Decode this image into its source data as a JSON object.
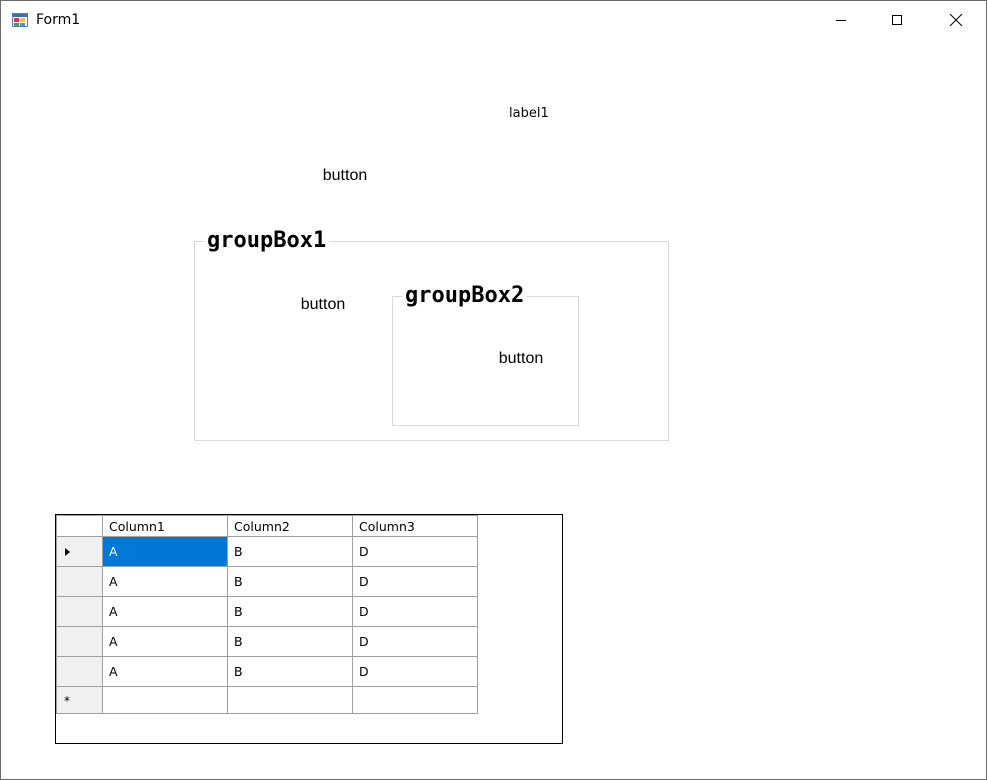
{
  "window": {
    "title": "Form1"
  },
  "label1": "label1",
  "buttons": {
    "top": "button",
    "group1": "button",
    "group2": "button"
  },
  "groupboxes": {
    "group1_title": "groupBox1",
    "group2_title": "groupBox2"
  },
  "grid": {
    "columns": [
      "Column1",
      "Column2",
      "Column3"
    ],
    "rows": [
      [
        "A",
        "B",
        "D"
      ],
      [
        "A",
        "B",
        "D"
      ],
      [
        "A",
        "B",
        "D"
      ],
      [
        "A",
        "B",
        "D"
      ],
      [
        "A",
        "B",
        "D"
      ]
    ],
    "new_row_marker": "*",
    "selected_cell": "row0-col0",
    "selection_color": "#0078d7"
  },
  "icons": {
    "app": "form-app-icon",
    "minimize": "minimize-icon",
    "maximize": "maximize-icon",
    "close": "close-icon"
  }
}
